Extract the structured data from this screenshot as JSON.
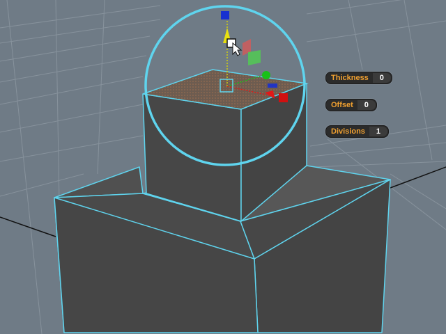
{
  "hud": {
    "thickness": {
      "label": "Thickness",
      "value": "0"
    },
    "offset": {
      "label": "Offset",
      "value": "0"
    },
    "divisions": {
      "label": "Divisions",
      "value": "1"
    }
  },
  "colors": {
    "background": "#6f7b86",
    "selection": "#5fd4ee",
    "grid": "#8a959f",
    "axis_x": "#e01818",
    "axis_y": "#18c018",
    "axis_z": "#1830d0",
    "hud_label": "#f0a030"
  },
  "icons": [
    "manipulator-ring",
    "move-arrow-x",
    "move-arrow-y",
    "move-arrow-z",
    "cursor-arrow-icon"
  ]
}
